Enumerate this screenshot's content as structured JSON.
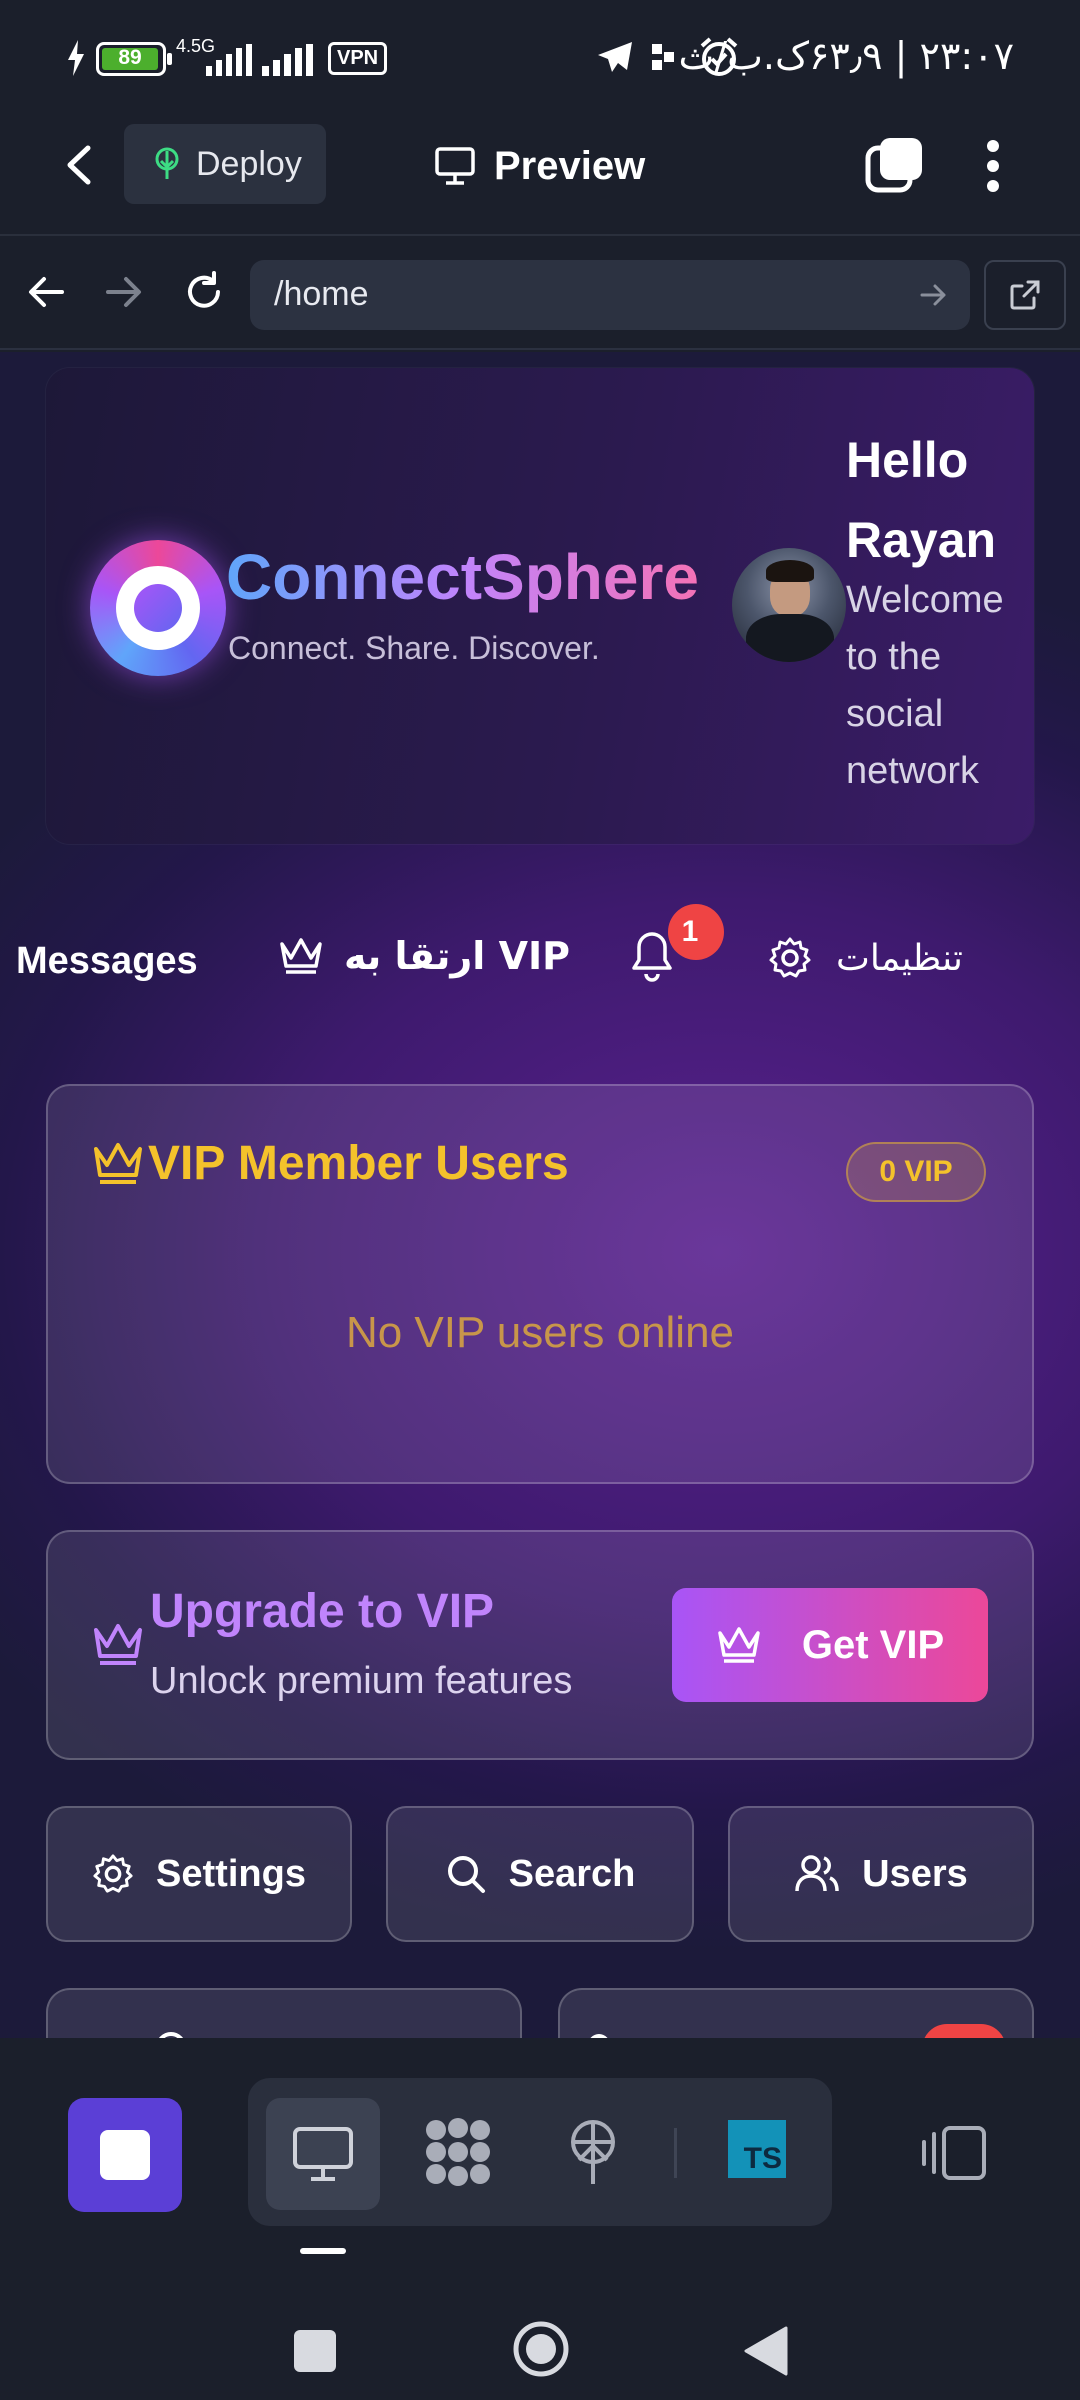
{
  "status_bar": {
    "battery": "89",
    "network": "4.5G",
    "vpn": "VPN",
    "time_text": "۲۳:۰۷ | ۶۳٫۹ک.ب/ث"
  },
  "app_bar": {
    "deploy_label": "Deploy",
    "preview_label": "Preview"
  },
  "url_bar": {
    "url": "/home"
  },
  "hero": {
    "brand_name": "ConnectSphere",
    "tagline": "Connect. Share. Discover.",
    "greeting": "Hello Rayan",
    "welcome": "Welcome to the social network"
  },
  "nav": {
    "messages": "Messages",
    "upgrade": "ارتقا به VIP",
    "notif_count": "1",
    "settings": "تنظیمات"
  },
  "vip_card": {
    "title": "VIP Member Users",
    "badge": "0 VIP",
    "empty": "No VIP users online"
  },
  "upgrade_card": {
    "title": "Upgrade to VIP",
    "subtitle": "Unlock premium features",
    "button": "Get VIP"
  },
  "quick_actions": {
    "settings": "Settings",
    "search": "Search",
    "users": "Users"
  },
  "bottom_toolbar": {
    "ts_label": "TS"
  },
  "colors": {
    "gold": "#f4c22b",
    "accent_purple": "#a855f7",
    "accent_pink": "#ec4899",
    "notif_red": "#ef4444"
  }
}
